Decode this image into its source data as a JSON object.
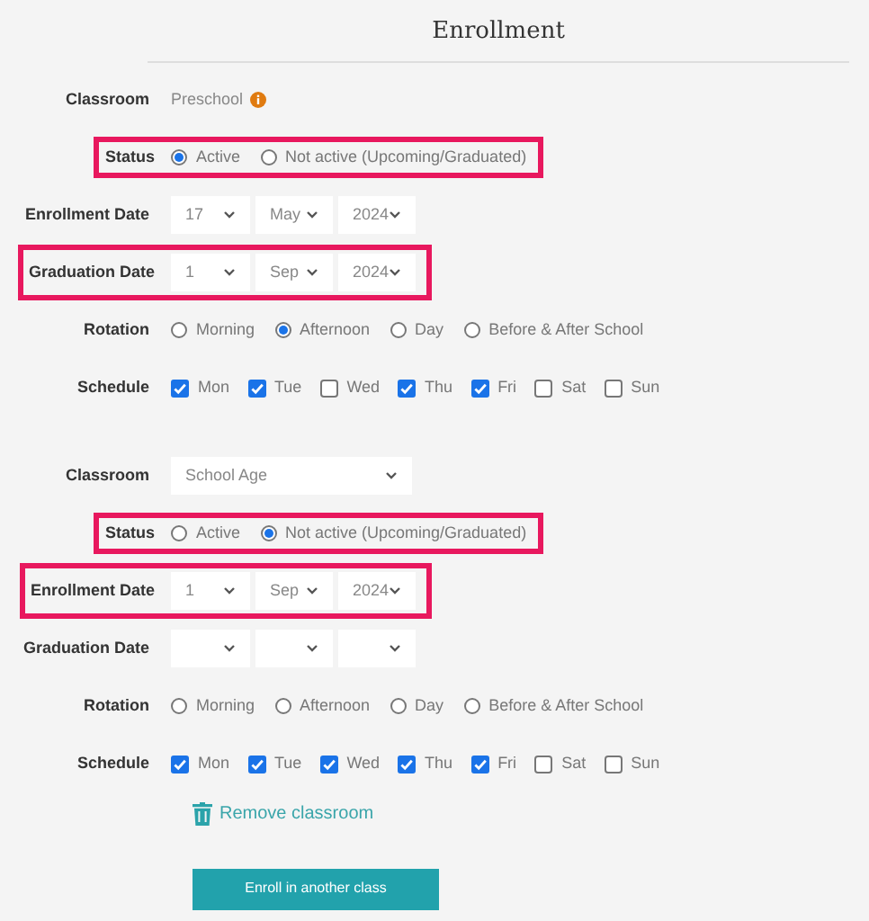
{
  "title": "Enrollment",
  "sections": [
    {
      "rows": [
        {
          "kind": "text",
          "label": "Classroom",
          "highlighted": false,
          "value": "Preschool",
          "info": true
        },
        {
          "kind": "radio",
          "label": "Status",
          "highlighted": true,
          "options": [
            {
              "label": "Active",
              "selected": true
            },
            {
              "label": "Not active (Upcoming/Graduated)",
              "selected": false
            }
          ]
        },
        {
          "kind": "date",
          "label": "Enrollment Date",
          "highlighted": false,
          "day": "17",
          "month": "May",
          "year": "2024"
        },
        {
          "kind": "date",
          "label": "Graduation Date",
          "highlighted": true,
          "day": "1",
          "month": "Sep",
          "year": "2024"
        },
        {
          "kind": "radio",
          "label": "Rotation",
          "highlighted": false,
          "options": [
            {
              "label": "Morning",
              "selected": false
            },
            {
              "label": "Afternoon",
              "selected": true
            },
            {
              "label": "Day",
              "selected": false
            },
            {
              "label": "Before & After School",
              "selected": false
            }
          ]
        },
        {
          "kind": "checks",
          "label": "Schedule",
          "highlighted": false,
          "options": [
            {
              "label": "Mon",
              "checked": true
            },
            {
              "label": "Tue",
              "checked": true
            },
            {
              "label": "Wed",
              "checked": false
            },
            {
              "label": "Thu",
              "checked": true
            },
            {
              "label": "Fri",
              "checked": true
            },
            {
              "label": "Sat",
              "checked": false
            },
            {
              "label": "Sun",
              "checked": false
            }
          ]
        }
      ]
    },
    {
      "rows": [
        {
          "kind": "select",
          "label": "Classroom",
          "highlighted": false,
          "value": "School Age"
        },
        {
          "kind": "radio",
          "label": "Status",
          "highlighted": true,
          "options": [
            {
              "label": "Active",
              "selected": false
            },
            {
              "label": "Not active (Upcoming/Graduated)",
              "selected": true
            }
          ]
        },
        {
          "kind": "date",
          "label": "Enrollment Date",
          "highlighted": true,
          "day": "1",
          "month": "Sep",
          "year": "2024"
        },
        {
          "kind": "date",
          "label": "Graduation Date",
          "highlighted": false
        },
        {
          "kind": "radio",
          "label": "Rotation",
          "highlighted": false,
          "options": [
            {
              "label": "Morning",
              "selected": false
            },
            {
              "label": "Afternoon",
              "selected": false
            },
            {
              "label": "Day",
              "selected": false
            },
            {
              "label": "Before & After School",
              "selected": false
            }
          ]
        },
        {
          "kind": "checks",
          "label": "Schedule",
          "highlighted": false,
          "options": [
            {
              "label": "Mon",
              "checked": true
            },
            {
              "label": "Tue",
              "checked": true
            },
            {
              "label": "Wed",
              "checked": true
            },
            {
              "label": "Thu",
              "checked": true
            },
            {
              "label": "Fri",
              "checked": true
            },
            {
              "label": "Sat",
              "checked": false
            },
            {
              "label": "Sun",
              "checked": false
            }
          ]
        }
      ],
      "remove_link": "Remove classroom"
    }
  ],
  "enroll_button": "Enroll in another class"
}
